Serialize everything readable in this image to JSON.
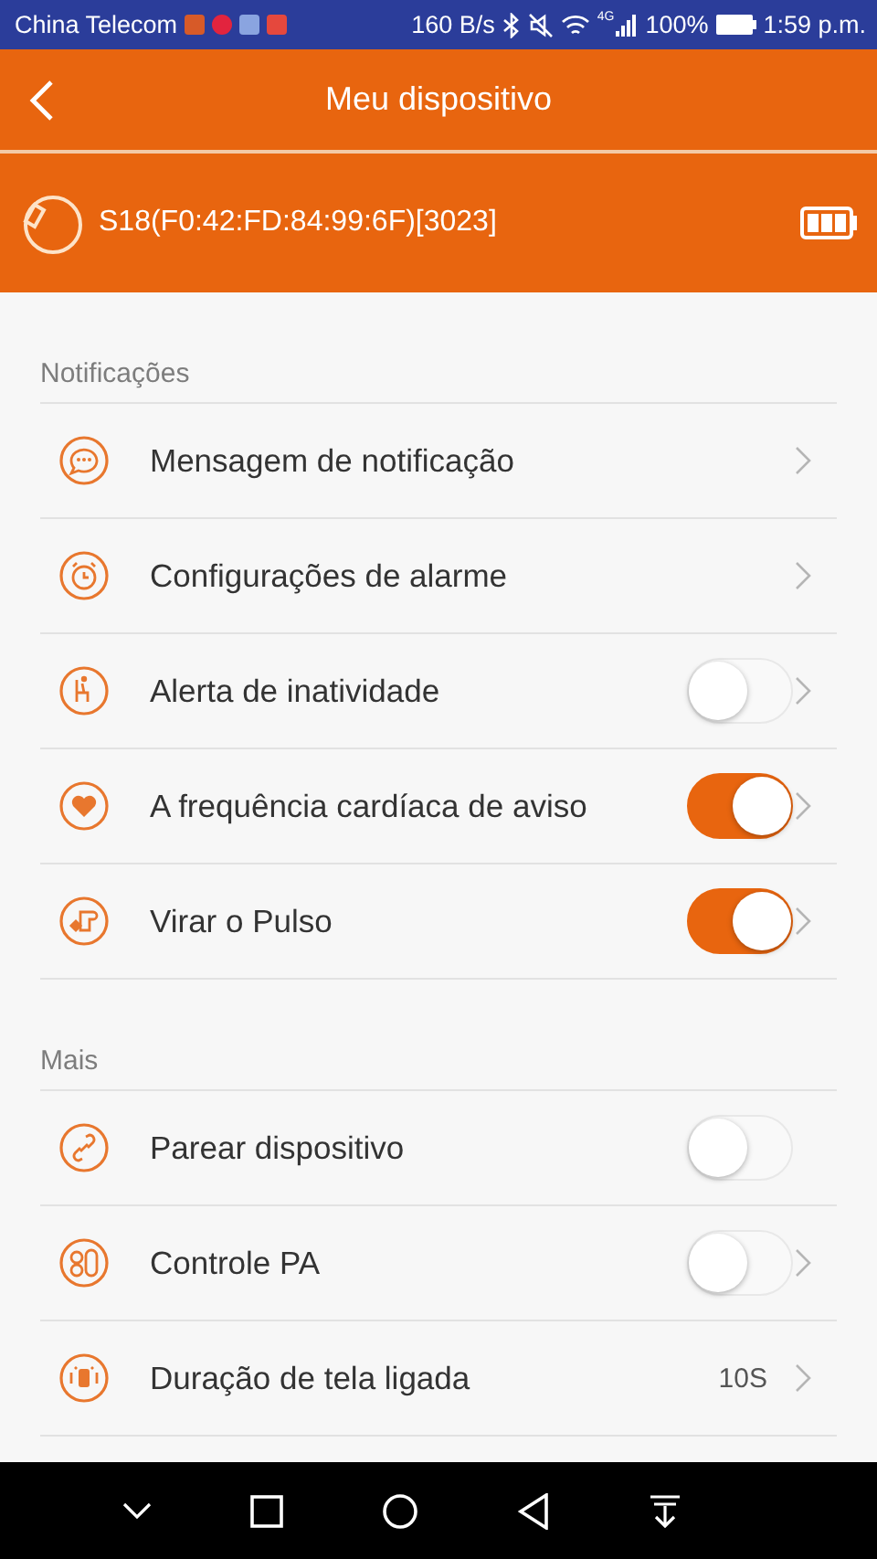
{
  "status_bar": {
    "carrier": "China Telecom",
    "speed": "160 B/s",
    "network": "4G",
    "battery": "100%",
    "time": "1:59 p.m."
  },
  "header": {
    "title": "Meu dispositivo"
  },
  "device": {
    "name": "S18(F0:42:FD:84:99:6F)[3023]"
  },
  "sections": [
    {
      "title": "Notificações",
      "rows": [
        {
          "kind": "link",
          "label": "Mensagem de notificação",
          "chevron": true
        },
        {
          "kind": "link",
          "label": "Configurações de alarme",
          "chevron": true
        },
        {
          "kind": "toggle",
          "label": "Alerta de inatividade",
          "on": false,
          "chevron": true
        },
        {
          "kind": "toggle",
          "label": "A frequência cardíaca de aviso",
          "on": true,
          "chevron": true
        },
        {
          "kind": "toggle",
          "label": "Virar o Pulso",
          "on": true,
          "chevron": true
        }
      ]
    },
    {
      "title": "Mais",
      "rows": [
        {
          "kind": "toggle",
          "label": "Parear dispositivo",
          "on": false,
          "chevron": false
        },
        {
          "kind": "toggle",
          "label": "Controle PA",
          "on": false,
          "chevron": true
        },
        {
          "kind": "value",
          "label": "Duração de tela ligada",
          "value": "10S",
          "chevron": true
        }
      ]
    }
  ]
}
